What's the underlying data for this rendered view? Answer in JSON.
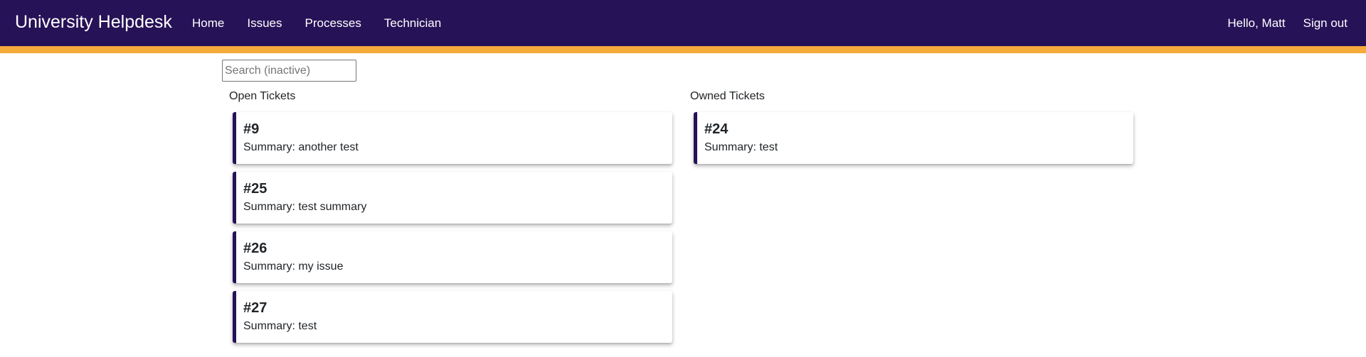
{
  "navbar": {
    "brand": "University Helpdesk",
    "links": [
      {
        "label": "Home"
      },
      {
        "label": "Issues"
      },
      {
        "label": "Processes"
      },
      {
        "label": "Technician"
      }
    ],
    "greeting": "Hello, Matt",
    "sign_out": "Sign out",
    "background_color": "#261257",
    "accent_color": "#f4ab3a"
  },
  "search": {
    "placeholder": "Search (inactive)",
    "value": ""
  },
  "open_tickets": {
    "heading": "Open Tickets",
    "items": [
      {
        "id": "#9",
        "summary": "Summary: another test"
      },
      {
        "id": "#25",
        "summary": "Summary: test summary"
      },
      {
        "id": "#26",
        "summary": "Summary: my issue"
      },
      {
        "id": "#27",
        "summary": "Summary: test"
      }
    ]
  },
  "owned_tickets": {
    "heading": "Owned Tickets",
    "items": [
      {
        "id": "#24",
        "summary": "Summary: test"
      }
    ]
  }
}
